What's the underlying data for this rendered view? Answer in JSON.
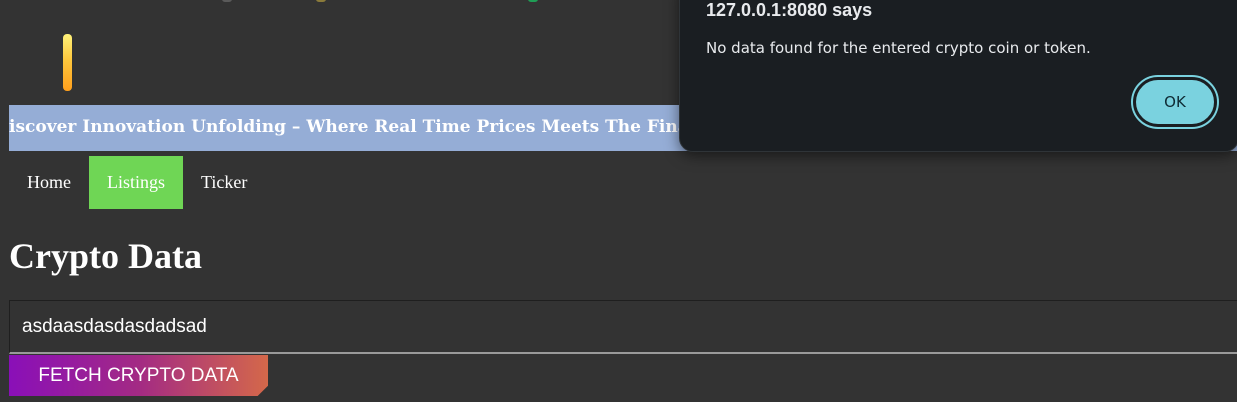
{
  "header": {
    "banner_text": "iscover Innovation Unfolding – Where Real Time Prices Meets The Financial T"
  },
  "nav": {
    "items": [
      {
        "label": "Home"
      },
      {
        "label": "Listings"
      },
      {
        "label": "Ticker"
      }
    ]
  },
  "main": {
    "title": "Crypto Data",
    "search_value": "asdaasdasdasdadsad",
    "fetch_label": "FETCH CRYPTO DATA"
  },
  "alert": {
    "title": "127.0.0.1:8080 says",
    "message": "No data found for the entered crypto coin or token.",
    "ok_label": "OK"
  },
  "colors": {
    "page_bg": "#333333",
    "banner_bg": "#95add6",
    "nav_active": "#6fd655",
    "button_gradient_start": "#8a0fb8",
    "button_gradient_end": "#d4684a",
    "dialog_bg": "#1a1e22",
    "dialog_ok": "#7ad2df"
  }
}
